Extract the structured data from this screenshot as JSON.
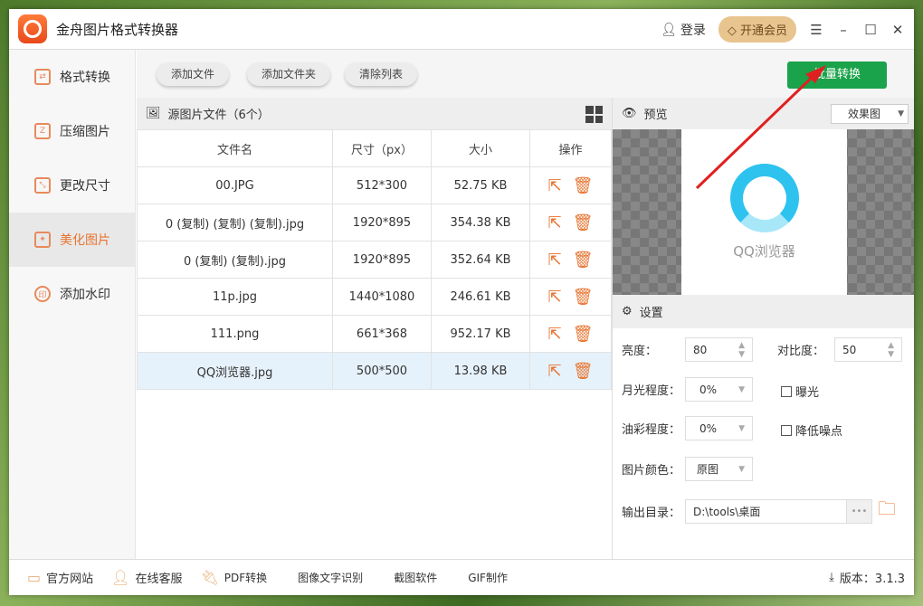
{
  "app": {
    "title": "金舟图片格式转换器",
    "login": "登录",
    "vip": "开通会员"
  },
  "sidebar": {
    "items": [
      {
        "label": "格式转换",
        "icon": "⇄"
      },
      {
        "label": "压缩图片",
        "icon": "Z"
      },
      {
        "label": "更改尺寸",
        "icon": "⤡"
      },
      {
        "label": "美化图片",
        "icon": "✦"
      },
      {
        "label": "添加水印",
        "icon": "印"
      }
    ]
  },
  "toolbar": {
    "add_file": "添加文件",
    "add_folder": "添加文件夹",
    "clear": "清除列表",
    "batch": "批量转换"
  },
  "files": {
    "header": "源图片文件（6个）",
    "columns": [
      "文件名",
      "尺寸（px）",
      "大小",
      "操作"
    ],
    "rows": [
      [
        "00.JPG",
        "512*300",
        "52.75 KB"
      ],
      [
        "0 (复制) (复制) (复制).jpg",
        "1920*895",
        "354.38 KB"
      ],
      [
        "0 (复制) (复制).jpg",
        "1920*895",
        "352.64 KB"
      ],
      [
        "11p.jpg",
        "1440*1080",
        "246.61 KB"
      ],
      [
        "111.png",
        "661*368",
        "952.17 KB"
      ],
      [
        "QQ浏览器.jpg",
        "500*500",
        "13.98 KB"
      ]
    ]
  },
  "preview": {
    "title": "预览",
    "mode": "效果图",
    "image_text": "QQ浏览器"
  },
  "settings": {
    "title": "设置",
    "brightness_label": "亮度：",
    "brightness": "80",
    "contrast_label": "对比度：",
    "contrast": "50",
    "moon_label": "月光程度：",
    "moon": "0%",
    "exposure": "曝光",
    "oil_label": "油彩程度：",
    "oil": "0%",
    "denoise": "降低噪点",
    "color_label": "图片颜色：",
    "color": "原图",
    "output_label": "输出目录：",
    "output": "D:\\tools\\桌面",
    "more": "•••"
  },
  "footer": {
    "items": [
      "官方网站",
      "在线客服",
      "PDF转换",
      "图像文字识别",
      "截图软件",
      "GIF制作"
    ],
    "version": "版本：3.1.3"
  },
  "colors": {
    "accent": "#e8732f",
    "green": "#1aa34a"
  }
}
